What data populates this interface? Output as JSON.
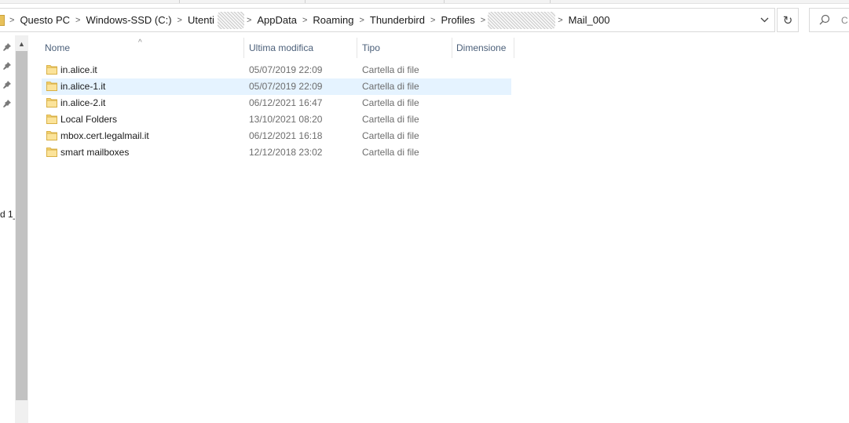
{
  "breadcrumb": {
    "items": [
      "Questo PC",
      "Windows-SSD (C:)",
      "Utenti",
      "AppData",
      "Roaming",
      "Thunderbird",
      "Profiles",
      "Mail_000"
    ],
    "separator": ">"
  },
  "toolbar": {
    "refresh_icon": "refresh-icon",
    "dropdown_icon": "chevron-down-icon",
    "search_placeholder": "C",
    "search_icon": "search-icon"
  },
  "nav_pane": {
    "partial_label": "d 1_",
    "pin_icon": "pin-icon"
  },
  "columns": {
    "name": "Nome",
    "modified": "Ultima modifica",
    "type": "Tipo",
    "size": "Dimensione"
  },
  "files": [
    {
      "name": "in.alice.it",
      "modified": "05/07/2019 22:09",
      "type": "Cartella di file",
      "size": ""
    },
    {
      "name": "in.alice-1.it",
      "modified": "05/07/2019 22:09",
      "type": "Cartella di file",
      "size": ""
    },
    {
      "name": "in.alice-2.it",
      "modified": "06/12/2021 16:47",
      "type": "Cartella di file",
      "size": ""
    },
    {
      "name": "Local Folders",
      "modified": "13/10/2021 08:20",
      "type": "Cartella di file",
      "size": ""
    },
    {
      "name": "mbox.cert.legalmail.it",
      "modified": "06/12/2021 16:18",
      "type": "Cartella di file",
      "size": ""
    },
    {
      "name": "smart mailboxes",
      "modified": "12/12/2018 23:02",
      "type": "Cartella di file",
      "size": ""
    }
  ],
  "colors": {
    "selection": "#e5f3ff",
    "header_text": "#4c607a",
    "folder_yellow": "#f8d775"
  }
}
